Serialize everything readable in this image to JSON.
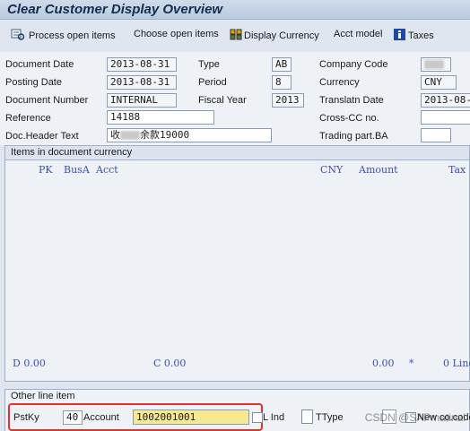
{
  "window": {
    "title": "Clear Customer Display Overview"
  },
  "toolbar": {
    "process_open_items": "Process open items",
    "choose_open_items": "Choose open items",
    "display_currency": "Display Currency",
    "acct_model": "Acct model",
    "taxes": "Taxes"
  },
  "header": {
    "document_date": {
      "label": "Document Date",
      "value": "2013-08-31"
    },
    "posting_date": {
      "label": "Posting Date",
      "value": "2013-08-31"
    },
    "document_number": {
      "label": "Document Number",
      "value": "INTERNAL"
    },
    "reference": {
      "label": "Reference",
      "value": "14188"
    },
    "doc_header_text": {
      "label": "Doc.Header Text",
      "value_pre": "收",
      "value_post": "余款19000"
    },
    "type": {
      "label": "Type",
      "value": "AB"
    },
    "period": {
      "label": "Period",
      "value": "8"
    },
    "fiscal_year": {
      "label": "Fiscal Year",
      "value": "2013"
    },
    "company_code": {
      "label": "Company Code",
      "value": ""
    },
    "currency": {
      "label": "Currency",
      "value": "CNY"
    },
    "translatn_date": {
      "label": "Translatn Date",
      "value": "2013-08-"
    },
    "cross_cc_no": {
      "label": "Cross-CC no.",
      "value": ""
    },
    "trading_part_ba": {
      "label": "Trading part.BA",
      "value": ""
    }
  },
  "items": {
    "title": "Items in document currency",
    "columns": {
      "pk": "PK",
      "busa": "BusA",
      "acct": "Acct",
      "currency": "CNY",
      "amount": "Amount",
      "tax": "Tax"
    },
    "totals": {
      "debit_label": "D",
      "debit_value": "0.00",
      "credit_label": "C",
      "credit_value": "0.00",
      "balance_value": "0.00",
      "balance_marker": "*",
      "line_count": "0 Line"
    }
  },
  "other_line_item": {
    "title": "Other line item",
    "pstky_label": "PstKy",
    "pstky_value": "40",
    "account_label": "Account",
    "account_value": "1002001001",
    "sgl_ind_label": "L Ind",
    "ttype_label": "TType",
    "new_co_code_label": "New co.code"
  },
  "watermark": "CSDN @SAPmatinal",
  "colors": {
    "title_text": "#162b4d",
    "column_text": "#3b4fb5",
    "highlight_frame": "#e0332d",
    "account_field": "#f7e98f"
  }
}
